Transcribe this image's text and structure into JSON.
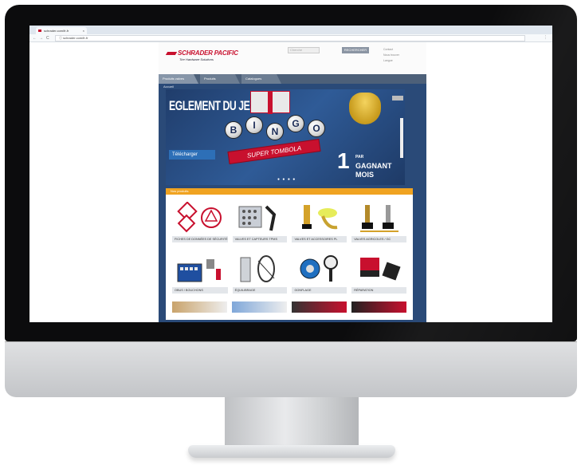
{
  "browser": {
    "tab_title": "schrader.com/fr-fr",
    "tab_close": "×",
    "nav_back": "←",
    "nav_forward": "→",
    "nav_reload": "C",
    "url": "ⓘ schrader.com/fr-fr",
    "menu": "⋮"
  },
  "site": {
    "logo": "SCHRADER PACIFIC",
    "tagline": "Tire Hardware Solutions",
    "search_placeholder": "Cherche",
    "search_button": "RECHERCHER",
    "header_links": [
      "Contact",
      "Nous trouver",
      "Langue"
    ],
    "nav_tabs": [
      "Produits valves",
      "Produits",
      "Catalogues"
    ],
    "breadcrumb": "Accueil"
  },
  "banner": {
    "headline": "EGLEMENT DU JEU",
    "download_button": "Télécharger",
    "bingo_letters": [
      "B",
      "I",
      "N",
      "G",
      "O"
    ],
    "ribbon": "SUPER TOMBOLA",
    "winner_number": "1",
    "winner_prefix": "PAR",
    "winner_text": "GAGNANT MOIS",
    "slider_dots": "● ● ● ●"
  },
  "products": {
    "section_title": "Nos produits",
    "items": [
      {
        "caption": "FICHES DE DONNÉES DE SÉCURITÉ",
        "icon": "hazard-icon"
      },
      {
        "caption": "VALVES ET CAPTEURS TPMS",
        "icon": "valve-kit-icon"
      },
      {
        "caption": "VALVES ET ACCESSOIRES PL",
        "icon": "truck-valve-icon"
      },
      {
        "caption": "VALVES AGRICOLES / GC",
        "icon": "agri-valve-icon"
      },
      {
        "caption": "OBUS / BOUCHONS",
        "icon": "valve-core-icon"
      },
      {
        "caption": "ÉQUILIBRAGE",
        "icon": "balancing-icon"
      },
      {
        "caption": "GONFLAGE",
        "icon": "inflation-icon"
      },
      {
        "caption": "RÉPARATION",
        "icon": "repair-icon"
      }
    ]
  }
}
